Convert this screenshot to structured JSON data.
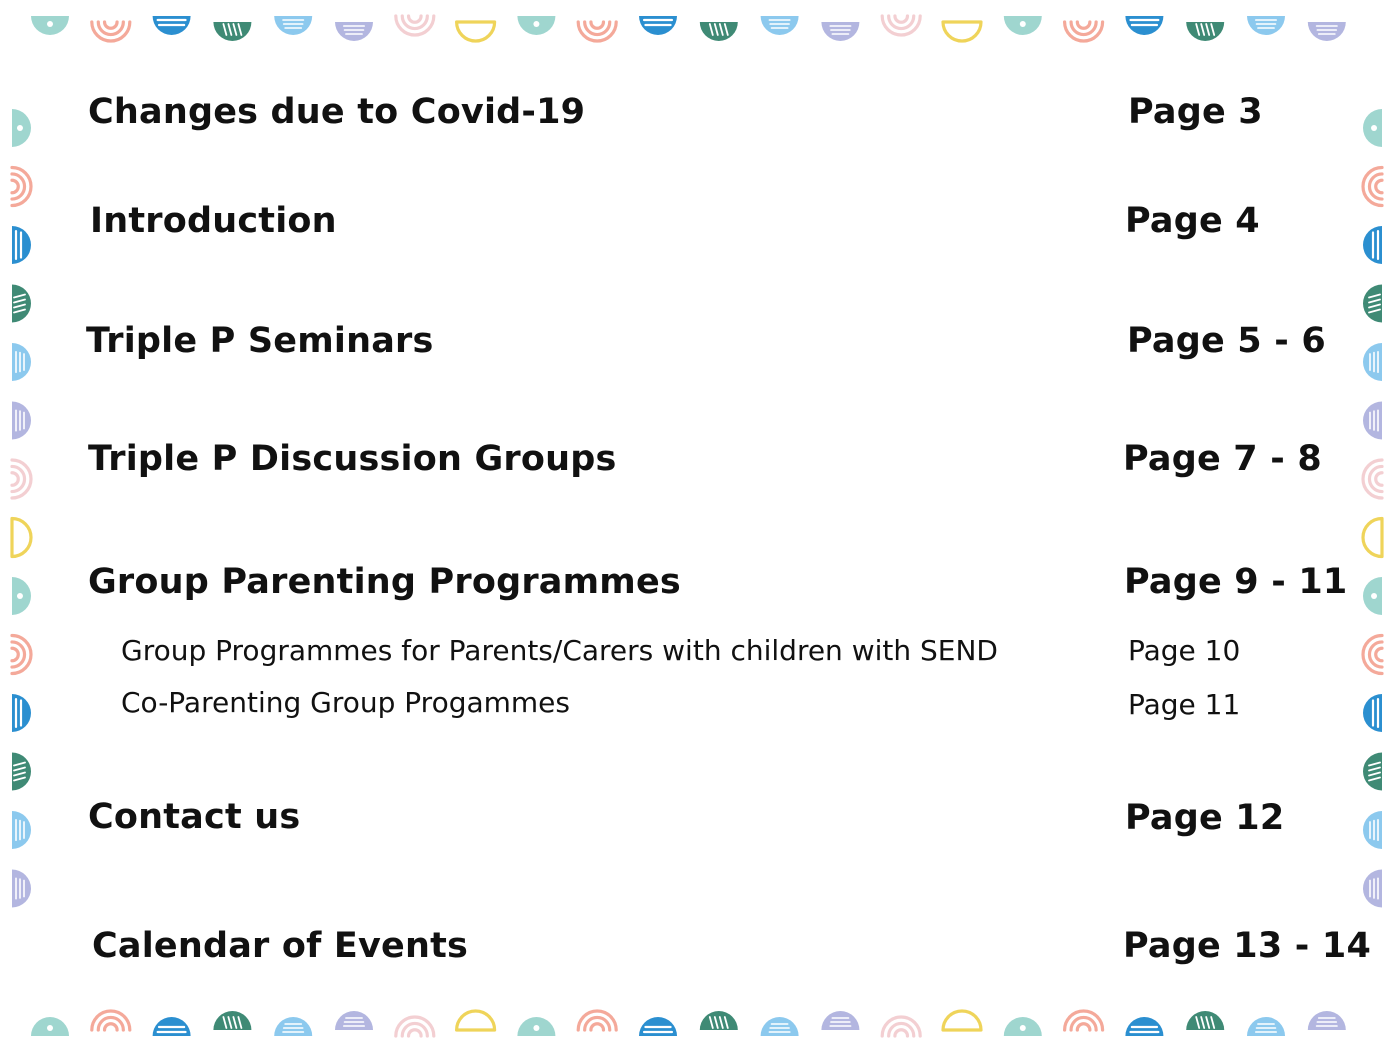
{
  "toc": {
    "entries": [
      {
        "title": "Changes due to Covid-19",
        "page": "Page 3"
      },
      {
        "title": "Introduction",
        "page": "Page 4"
      },
      {
        "title": "Triple P Seminars",
        "page": "Page 5 - 6"
      },
      {
        "title": "Triple P Discussion Groups",
        "page": "Page 7 - 8"
      },
      {
        "title": "Group Parenting Programmes",
        "page": "Page 9 - 11"
      },
      {
        "title": "Contact us",
        "page": "Page 12"
      },
      {
        "title": "Calendar of Events",
        "page": "Page 13 - 14"
      }
    ],
    "subentries": [
      {
        "title": "Group Programmes for Parents/Carers with children with SEND",
        "page": "Page 10"
      },
      {
        "title": "Co-Parenting Group Progammes",
        "page": "Page 11"
      }
    ]
  },
  "border": {
    "icons": [
      "half-circle-dot-icon",
      "concentric-arc-icon",
      "striped-half-circle-icon",
      "scribble-half-circle-icon",
      "lined-half-circle-icon",
      "outline-half-circle-icon"
    ],
    "palette": [
      "#9fd6cf",
      "#f4a99a",
      "#2b8fd0",
      "#3f8a75",
      "#8cc9ee",
      "#b3b6e0",
      "#f3cfd2",
      "#efd45a"
    ]
  }
}
